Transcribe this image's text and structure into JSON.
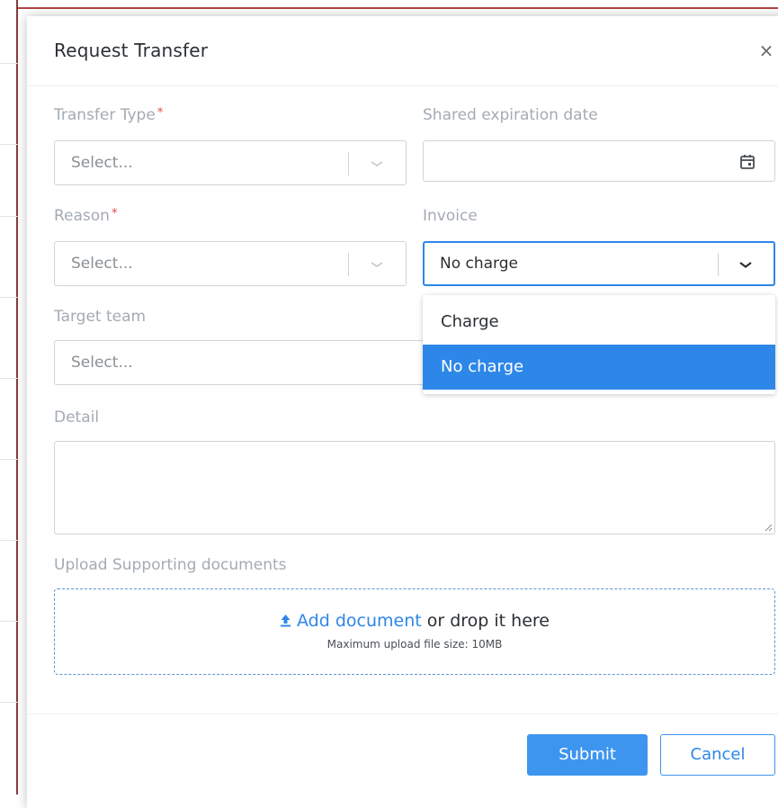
{
  "dialog": {
    "title": "Request Transfer",
    "close": "×"
  },
  "fields": {
    "transfer_type": {
      "label": "Transfer Type",
      "required_mark": "*",
      "placeholder": "Select..."
    },
    "expiration": {
      "label": "Shared expiration date",
      "value": ""
    },
    "reason": {
      "label": "Reason",
      "required_mark": "*",
      "placeholder": "Select..."
    },
    "invoice": {
      "label": "Invoice",
      "value": "No charge"
    },
    "target_team": {
      "label": "Target team",
      "placeholder": "Select..."
    },
    "detail": {
      "label": "Detail",
      "value": ""
    },
    "upload": {
      "label": "Upload Supporting documents",
      "link_text": "Add document",
      "suffix_text": " or drop it here",
      "hint": "Maximum upload file size: 10MB"
    }
  },
  "invoice_menu": {
    "options": [
      {
        "label": "Charge",
        "selected": false
      },
      {
        "label": "No charge",
        "selected": true
      }
    ]
  },
  "actions": {
    "submit_label": "Submit",
    "cancel_label": "Cancel"
  },
  "colors": {
    "accent": "#2d87e8",
    "required": "#e04848",
    "label": "#a3abb3"
  },
  "icons": [
    "close-icon",
    "chevron-down-icon",
    "calendar-icon",
    "upload-icon",
    "resize-grip-icon"
  ]
}
